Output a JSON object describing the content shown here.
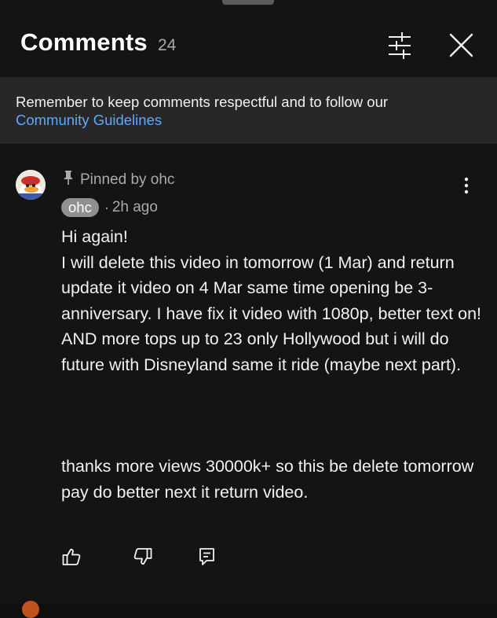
{
  "header": {
    "title": "Comments",
    "count": "24",
    "filter_icon": "sliders-icon",
    "close_icon": "close-icon"
  },
  "notice": {
    "text": "Remember to keep comments respectful and to follow our",
    "link": "Community Guidelines"
  },
  "comment": {
    "pinned_label": "Pinned by ohc",
    "author": "ohc",
    "separator": "·",
    "time": "2h ago",
    "paragraphs": [
      "Hi again!",
      "I will delete this video in tomorrow (1 Mar) and return update it video on 4 Mar same time opening be 3-anniversary. I have fix it video with 1080p, better text on! AND more tops up to 23 only Hollywood but i will do future with Disneyland same it ride (maybe next part).",
      "thanks more views 30000k+ so this be delete tomorrow pay do better next it return video."
    ],
    "actions": {
      "like_icon": "thumbs-up-icon",
      "dislike_icon": "thumbs-down-icon",
      "reply_icon": "reply-icon"
    }
  },
  "colors": {
    "background": "#141414",
    "notice_background": "#272727",
    "link": "#5ea8ff",
    "secondary_text": "#aaaaaa",
    "author_chip": "#909090"
  }
}
